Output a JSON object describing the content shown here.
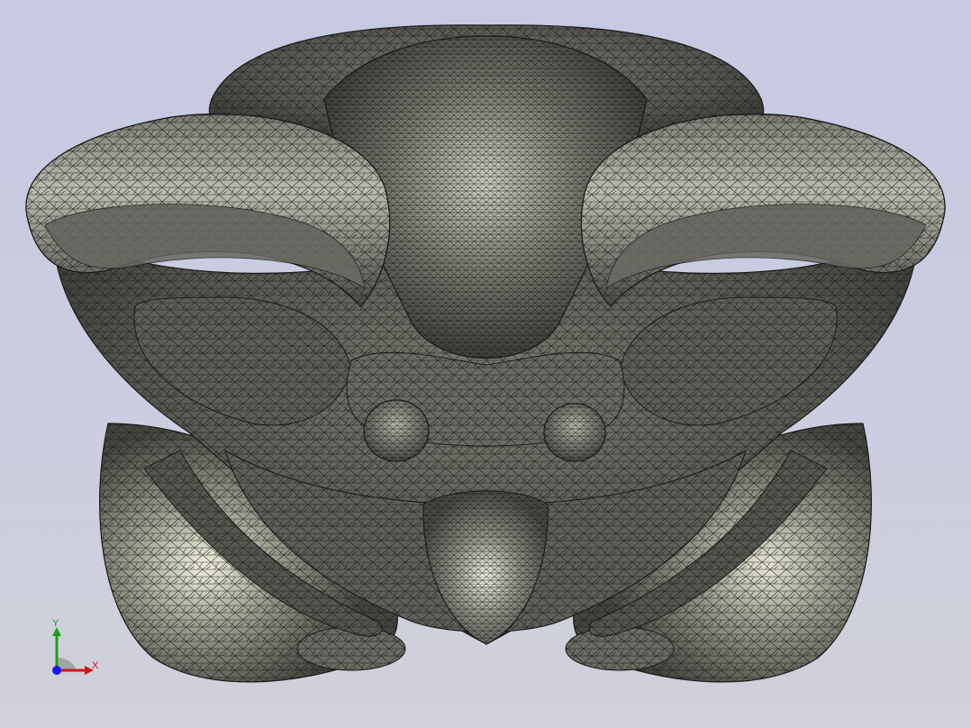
{
  "viewport": {
    "background_top": "#c6c9e1",
    "background_bottom": "#d0d1d9",
    "mesh_color": "#161616",
    "surface_colors": [
      "#5a5a55",
      "#8c8c80",
      "#e8e8d6"
    ]
  },
  "model": {
    "render_mode": "shaded-with-mesh-edges",
    "view": "front"
  },
  "triad": {
    "x_label": "X",
    "y_label": "Y",
    "x_color": "#d01818",
    "y_color": "#19a019",
    "z_color": "#1a1aee"
  }
}
